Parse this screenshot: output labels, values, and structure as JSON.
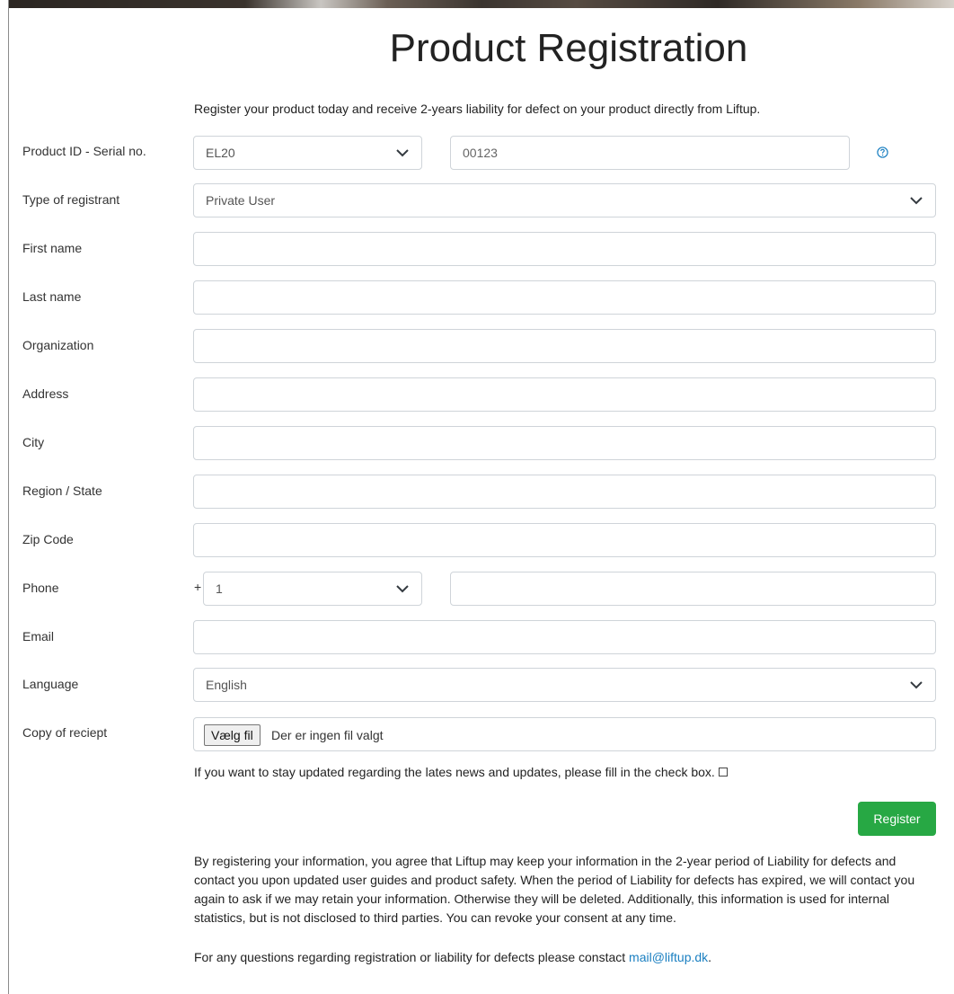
{
  "page": {
    "title": "Product Registration",
    "intro": "Register your product today and receive 2-years liability for defect on your product directly from Liftup."
  },
  "form": {
    "product_id": {
      "label": "Product ID - Serial no.",
      "model_value": "EL20",
      "serial_value": "00123"
    },
    "registrant_type": {
      "label": "Type of registrant",
      "value": "Private User"
    },
    "first_name": {
      "label": "First name",
      "value": ""
    },
    "last_name": {
      "label": "Last name",
      "value": ""
    },
    "organization": {
      "label": "Organization",
      "value": ""
    },
    "address": {
      "label": "Address",
      "value": ""
    },
    "city": {
      "label": "City",
      "value": ""
    },
    "region": {
      "label": "Region / State",
      "value": ""
    },
    "zip": {
      "label": "Zip Code",
      "value": ""
    },
    "phone": {
      "label": "Phone",
      "prefix": "+",
      "country_code": "1",
      "number": ""
    },
    "email": {
      "label": "Email",
      "value": ""
    },
    "language": {
      "label": "Language",
      "value": "English"
    },
    "receipt": {
      "label": "Copy of reciept",
      "button_label": "Vælg fil",
      "status": "Der er ingen fil valgt"
    },
    "updates_text": "If you want to stay updated regarding the lates news and updates, please fill in the check box.",
    "updates_checked": false,
    "submit_label": "Register"
  },
  "footer": {
    "consent": "By registering your information, you agree that Liftup may keep your information in the 2-year period of Liability for defects and contact you upon updated user guides and product safety. When the period of Liability for defects has expired, we will contact you again to ask if we may retain your information. Otherwise they will be deleted. Additionally, this information is used for internal statistics, but is not disclosed to third parties. You can revoke your consent at any time.",
    "contact_prefix": "For any questions regarding registration or liability for defects please constact",
    "contact_email": "mail@liftup.dk",
    "contact_suffix": "."
  },
  "colors": {
    "accent_link": "#1a7fc1",
    "register_button": "#27a844",
    "input_border": "#cfd4d9"
  },
  "icons": {
    "help": "question-circle-icon",
    "select_arrow": "chevron-down-icon"
  }
}
